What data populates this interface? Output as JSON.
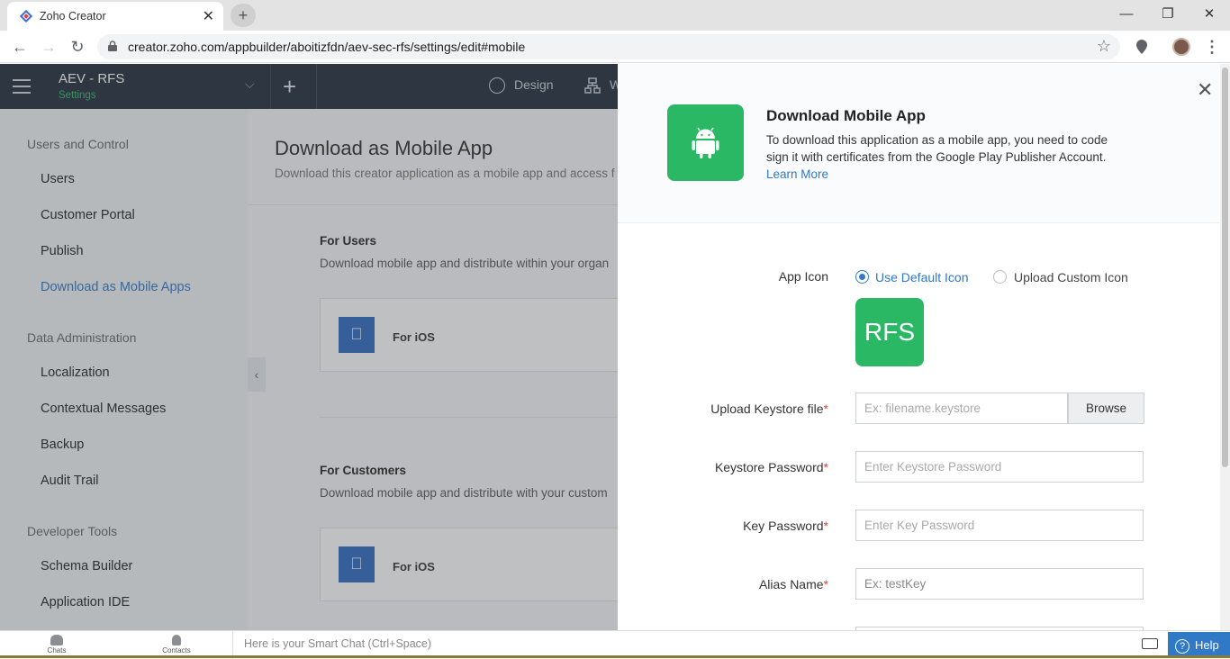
{
  "browser": {
    "tab_title": "Zoho Creator",
    "tab_close": "✕",
    "new_tab": "+",
    "url": "creator.zoho.com/appbuilder/aboitizfdn/aev-sec-rfs/settings/edit#mobile",
    "win_min": "—",
    "win_restore": "❐",
    "win_close": "✕",
    "back": "←",
    "forward": "→",
    "reload": "↻",
    "star": "☆"
  },
  "app_header": {
    "app_name": "AEV - RFS",
    "subtitle": "Settings",
    "chevron": "⌵",
    "add": "+",
    "design_label": "Design",
    "w_label": "W"
  },
  "sidebar": {
    "groups": [
      {
        "label": "Users and Control",
        "items": [
          "Users",
          "Customer Portal",
          "Publish",
          "Download as Mobile Apps"
        ]
      },
      {
        "label": "Data Administration",
        "items": [
          "Localization",
          "Contextual Messages",
          "Backup",
          "Audit Trail"
        ]
      },
      {
        "label": "Developer Tools",
        "items": [
          "Schema Builder",
          "Application IDE"
        ]
      }
    ],
    "active_item": "Download as Mobile Apps",
    "collapse": "‹"
  },
  "main": {
    "title": "Download as Mobile App",
    "description": "Download this creator application as a mobile app and access f",
    "for_users": {
      "title": "For Users",
      "description": "Download mobile app and distribute within your organ",
      "card_label": "For iOS"
    },
    "for_customers": {
      "title": "For Customers",
      "description": "Download mobile app and distribute with your custom",
      "card_label": "For iOS"
    }
  },
  "panel": {
    "title": "Download Mobile App",
    "desc_line1": "To download this application as a mobile app, you need to code",
    "desc_line2": "sign it with certificates from the Google Play Publisher Account.",
    "learn_more": "Learn More",
    "close": "✕",
    "app_icon_label": "App Icon",
    "radio_default": "Use Default Icon",
    "radio_custom": "Upload Custom Icon",
    "default_icon_text": "RFS",
    "keystore_label": "Upload Keystore file",
    "keystore_placeholder": "Ex: filename.keystore",
    "browse": "Browse",
    "keystore_password_label": "Keystore Password",
    "keystore_password_placeholder": "Enter Keystore Password",
    "key_password_label": "Key Password",
    "key_password_placeholder": "Enter Key Password",
    "alias_label": "Alias Name",
    "alias_placeholder": "Ex: testKey",
    "required_mark": "*"
  },
  "bottom_bar": {
    "chats": "Chats",
    "contacts": "Contacts",
    "smart_chat": "Here is your Smart Chat (Ctrl+Space)",
    "help": "Help",
    "help_icon": "?"
  },
  "colors": {
    "accent_blue": "#2f79c7",
    "android_green": "#2bb865",
    "header_dark": "#232d3a",
    "ios_blue": "#2e6bc1",
    "required_red": "#d9453d"
  }
}
